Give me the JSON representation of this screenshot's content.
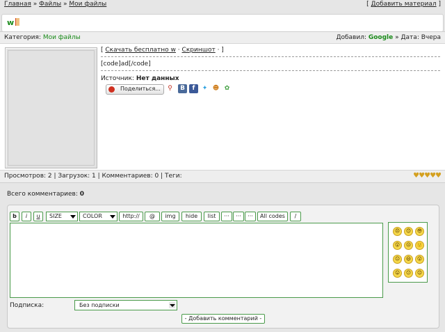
{
  "nav": {
    "home": "Главная",
    "sep1": "»",
    "files": "Файлы",
    "sep2": "»",
    "my_files": "Мои файлы",
    "add_material": "Добавить материал",
    "bracket_open": "[",
    "bracket_close": "]"
  },
  "entry": {
    "title": "w",
    "category_label": "Категория:",
    "category_value": "Мои файлы",
    "added_label": "Добавил:",
    "added_by": "Google",
    "date_sep": "»",
    "date_label": "Дата:",
    "date_value": "Вчера",
    "download_open": "[",
    "download_link": "Скачать бесплатно w",
    "download_dot": "·",
    "screenshot_link": "Скриншот",
    "download_close": "· ]",
    "code_text": "[code]ad[/code]",
    "source_label": "Источник:",
    "source_value": "Нет данных",
    "share_label": "Поделиться...",
    "vk_letter": "B",
    "fb_letter": "f",
    "stats_text": "Просмотров: 2 | Загрузок: 1 | Комментариев: 0 | Теги:",
    "rating_hearts": "♥♥♥♥♥"
  },
  "comments": {
    "total_label": "Всего комментариев:",
    "total_value": "0",
    "toolbar": {
      "bold": "b",
      "italic": "i",
      "underline": "u",
      "size": "SIZE",
      "color": "COLOR",
      "http": "http://",
      "at": "@",
      "img": "img",
      "hide": "hide",
      "list": "list",
      "more1": "···",
      "more2": "···",
      "more3": "···",
      "all_codes": "All codes",
      "slash": "/"
    },
    "subscription_label": "Подписка:",
    "subscription_value": "Без подписки",
    "submit_label": "- Добавить комментарий -"
  },
  "colors": {
    "accent_green": "#1a8a1a",
    "border_green": "#4a9a4a"
  },
  "smileys": [
    "😠",
    "😊",
    "😎",
    "😲",
    "😒",
    "🙂",
    "😐",
    "😃",
    "😮",
    "😛",
    "😕",
    "😌"
  ]
}
